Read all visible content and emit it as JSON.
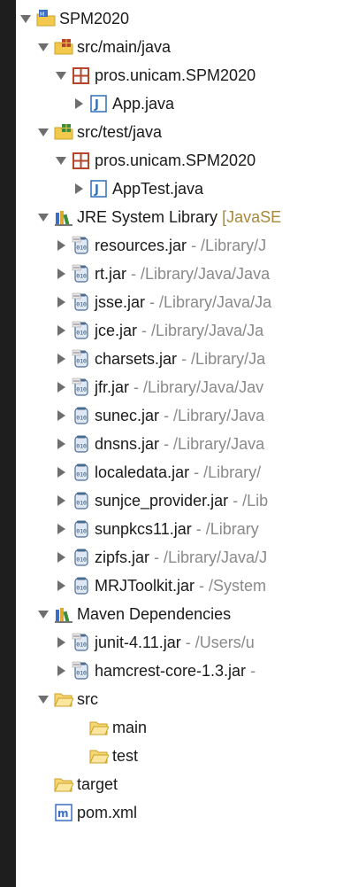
{
  "tree": {
    "project": "SPM2020",
    "src_main_java": "src/main/java",
    "pkg_main": "pros.unicam.SPM2020",
    "app_java": "App.java",
    "src_test_java": "src/test/java",
    "pkg_test": "pros.unicam.SPM2020",
    "apptest_java": "AppTest.java",
    "jre_lib": "JRE System Library",
    "jre_lib_decoration": "[JavaSE",
    "jre_jars": [
      {
        "name": "resources.jar",
        "path": "- /Library/J"
      },
      {
        "name": "rt.jar",
        "path": "- /Library/Java/Java"
      },
      {
        "name": "jsse.jar",
        "path": "- /Library/Java/Ja"
      },
      {
        "name": "jce.jar",
        "path": "- /Library/Java/Ja"
      },
      {
        "name": "charsets.jar",
        "path": "- /Library/Ja"
      },
      {
        "name": "jfr.jar",
        "path": "- /Library/Java/Jav"
      },
      {
        "name": "sunec.jar",
        "path": "- /Library/Java"
      },
      {
        "name": "dnsns.jar",
        "path": "- /Library/Java"
      },
      {
        "name": "localedata.jar",
        "path": "- /Library/"
      },
      {
        "name": "sunjce_provider.jar",
        "path": "- /Lib"
      },
      {
        "name": "sunpkcs11.jar",
        "path": "- /Library"
      },
      {
        "name": "zipfs.jar",
        "path": "- /Library/Java/J"
      },
      {
        "name": "MRJToolkit.jar",
        "path": "- /System"
      }
    ],
    "maven_deps": "Maven Dependencies",
    "maven_jars": [
      {
        "name": "junit-4.11.jar",
        "path": "- /Users/u"
      },
      {
        "name": "hamcrest-core-1.3.jar",
        "path": "-"
      }
    ],
    "src": "src",
    "main": "main",
    "test": "test",
    "target": "target",
    "pom": "pom.xml"
  },
  "colors": {
    "background": "#1e1e1e",
    "panel": "#ffffff",
    "decoration": "#8a8a8a",
    "library_decoration": "#a7893b",
    "folder_yellow": "#f2c94c",
    "package_red": "#b5462c",
    "java_blue": "#2f6fb5",
    "maven_blue": "#3b6fc4"
  }
}
